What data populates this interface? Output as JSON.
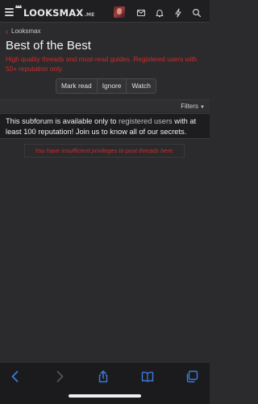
{
  "header": {
    "logo": "LOOKSMAX",
    "logo_suffix": ".ME",
    "icons": [
      "hamburger-icon",
      "avatar",
      "mail-icon",
      "bell-icon",
      "bolt-icon",
      "search-icon"
    ]
  },
  "breadcrumb": {
    "label": "Looksmax"
  },
  "page": {
    "title": "Best of the Best",
    "description": "High quality threads and must-read guides. Registered users with 50+ reputation only."
  },
  "actions": {
    "mark_read": "Mark read",
    "ignore": "Ignore",
    "watch": "Watch"
  },
  "filters": {
    "label": "Filters"
  },
  "notice": {
    "part1": "This subforum is available only to ",
    "link": "registered users",
    "part2": " with at least 100 reputation! Join us to know all of our secrets."
  },
  "warning": "You have insufficient privileges to post threads here.",
  "colors": {
    "accent_red": "#d12b2b",
    "link_blue": "#3d7bd9",
    "background": "#2b2b2d"
  }
}
